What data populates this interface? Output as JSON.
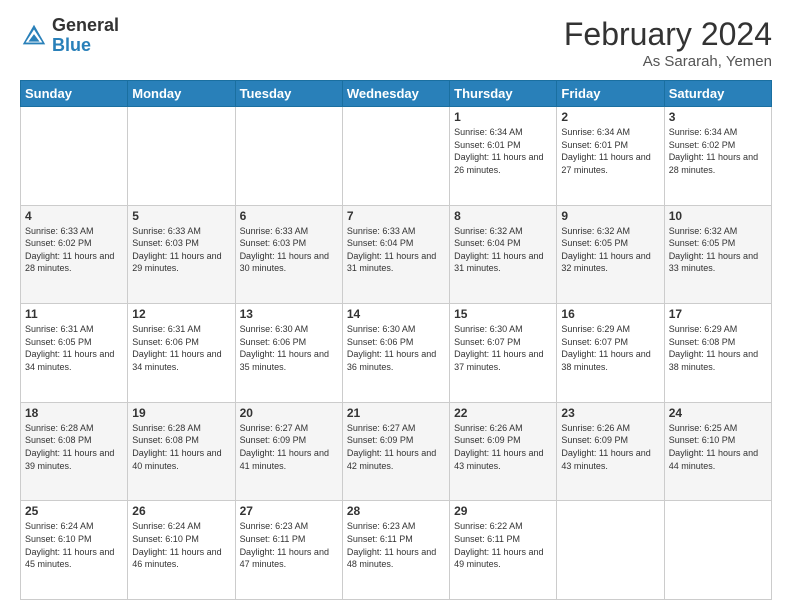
{
  "logo": {
    "general": "General",
    "blue": "Blue"
  },
  "header": {
    "month": "February 2024",
    "location": "As Sararah, Yemen"
  },
  "days_of_week": [
    "Sunday",
    "Monday",
    "Tuesday",
    "Wednesday",
    "Thursday",
    "Friday",
    "Saturday"
  ],
  "weeks": [
    [
      {
        "day": "",
        "info": ""
      },
      {
        "day": "",
        "info": ""
      },
      {
        "day": "",
        "info": ""
      },
      {
        "day": "",
        "info": ""
      },
      {
        "day": "1",
        "info": "Sunrise: 6:34 AM\nSunset: 6:01 PM\nDaylight: 11 hours and 26 minutes."
      },
      {
        "day": "2",
        "info": "Sunrise: 6:34 AM\nSunset: 6:01 PM\nDaylight: 11 hours and 27 minutes."
      },
      {
        "day": "3",
        "info": "Sunrise: 6:34 AM\nSunset: 6:02 PM\nDaylight: 11 hours and 28 minutes."
      }
    ],
    [
      {
        "day": "4",
        "info": "Sunrise: 6:33 AM\nSunset: 6:02 PM\nDaylight: 11 hours and 28 minutes."
      },
      {
        "day": "5",
        "info": "Sunrise: 6:33 AM\nSunset: 6:03 PM\nDaylight: 11 hours and 29 minutes."
      },
      {
        "day": "6",
        "info": "Sunrise: 6:33 AM\nSunset: 6:03 PM\nDaylight: 11 hours and 30 minutes."
      },
      {
        "day": "7",
        "info": "Sunrise: 6:33 AM\nSunset: 6:04 PM\nDaylight: 11 hours and 31 minutes."
      },
      {
        "day": "8",
        "info": "Sunrise: 6:32 AM\nSunset: 6:04 PM\nDaylight: 11 hours and 31 minutes."
      },
      {
        "day": "9",
        "info": "Sunrise: 6:32 AM\nSunset: 6:05 PM\nDaylight: 11 hours and 32 minutes."
      },
      {
        "day": "10",
        "info": "Sunrise: 6:32 AM\nSunset: 6:05 PM\nDaylight: 11 hours and 33 minutes."
      }
    ],
    [
      {
        "day": "11",
        "info": "Sunrise: 6:31 AM\nSunset: 6:05 PM\nDaylight: 11 hours and 34 minutes."
      },
      {
        "day": "12",
        "info": "Sunrise: 6:31 AM\nSunset: 6:06 PM\nDaylight: 11 hours and 34 minutes."
      },
      {
        "day": "13",
        "info": "Sunrise: 6:30 AM\nSunset: 6:06 PM\nDaylight: 11 hours and 35 minutes."
      },
      {
        "day": "14",
        "info": "Sunrise: 6:30 AM\nSunset: 6:06 PM\nDaylight: 11 hours and 36 minutes."
      },
      {
        "day": "15",
        "info": "Sunrise: 6:30 AM\nSunset: 6:07 PM\nDaylight: 11 hours and 37 minutes."
      },
      {
        "day": "16",
        "info": "Sunrise: 6:29 AM\nSunset: 6:07 PM\nDaylight: 11 hours and 38 minutes."
      },
      {
        "day": "17",
        "info": "Sunrise: 6:29 AM\nSunset: 6:08 PM\nDaylight: 11 hours and 38 minutes."
      }
    ],
    [
      {
        "day": "18",
        "info": "Sunrise: 6:28 AM\nSunset: 6:08 PM\nDaylight: 11 hours and 39 minutes."
      },
      {
        "day": "19",
        "info": "Sunrise: 6:28 AM\nSunset: 6:08 PM\nDaylight: 11 hours and 40 minutes."
      },
      {
        "day": "20",
        "info": "Sunrise: 6:27 AM\nSunset: 6:09 PM\nDaylight: 11 hours and 41 minutes."
      },
      {
        "day": "21",
        "info": "Sunrise: 6:27 AM\nSunset: 6:09 PM\nDaylight: 11 hours and 42 minutes."
      },
      {
        "day": "22",
        "info": "Sunrise: 6:26 AM\nSunset: 6:09 PM\nDaylight: 11 hours and 43 minutes."
      },
      {
        "day": "23",
        "info": "Sunrise: 6:26 AM\nSunset: 6:09 PM\nDaylight: 11 hours and 43 minutes."
      },
      {
        "day": "24",
        "info": "Sunrise: 6:25 AM\nSunset: 6:10 PM\nDaylight: 11 hours and 44 minutes."
      }
    ],
    [
      {
        "day": "25",
        "info": "Sunrise: 6:24 AM\nSunset: 6:10 PM\nDaylight: 11 hours and 45 minutes."
      },
      {
        "day": "26",
        "info": "Sunrise: 6:24 AM\nSunset: 6:10 PM\nDaylight: 11 hours and 46 minutes."
      },
      {
        "day": "27",
        "info": "Sunrise: 6:23 AM\nSunset: 6:11 PM\nDaylight: 11 hours and 47 minutes."
      },
      {
        "day": "28",
        "info": "Sunrise: 6:23 AM\nSunset: 6:11 PM\nDaylight: 11 hours and 48 minutes."
      },
      {
        "day": "29",
        "info": "Sunrise: 6:22 AM\nSunset: 6:11 PM\nDaylight: 11 hours and 49 minutes."
      },
      {
        "day": "",
        "info": ""
      },
      {
        "day": "",
        "info": ""
      }
    ]
  ]
}
